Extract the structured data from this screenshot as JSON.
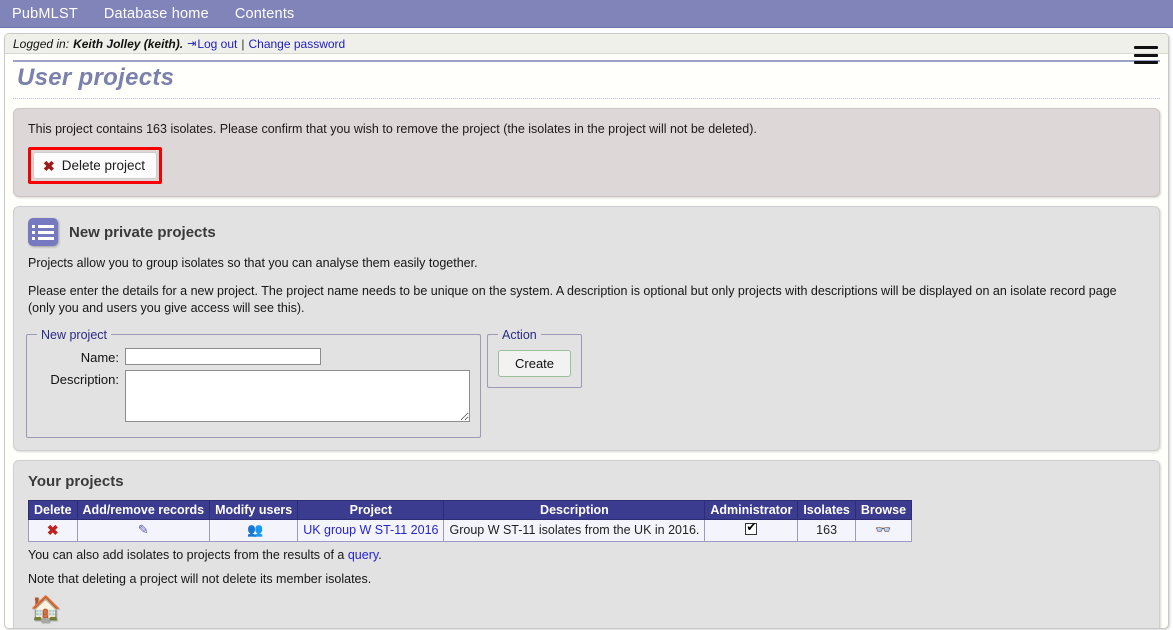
{
  "topnav": {
    "items": [
      {
        "label": "PubMLST",
        "name": "nav-pubmlst"
      },
      {
        "label": "Database home",
        "name": "nav-database-home"
      },
      {
        "label": "Contents",
        "name": "nav-contents"
      }
    ]
  },
  "loginbar": {
    "prefix": "Logged in:",
    "user": "Keith Jolley (keith).",
    "logout_icon": "logout-icon",
    "logout_label": "Log out",
    "separator": "|",
    "change_password_label": "Change password",
    "menu_icon": "hamburger-menu-icon"
  },
  "page": {
    "title": "User projects"
  },
  "warning": {
    "message": "This project contains 163 isolates. Please confirm that you wish to remove the project (the isolates in the project will not be deleted).",
    "isolate_count": "163",
    "delete_button_label": "Delete project",
    "delete_icon": "cross-icon",
    "annotation_color": "#f60000",
    "background_color": "#ded7d7"
  },
  "new_projects": {
    "icon": "list-icon",
    "heading": "New private projects",
    "paragraph1": "Projects allow you to group isolates so that you can analyse them easily together.",
    "paragraph2": "Please enter the details for a new project. The project name needs to be unique on the system. A description is optional but only projects with descriptions will be displayed on an isolate record page (only you and users you give access will see this).",
    "fieldset_legend": "New project",
    "action_legend": "Action",
    "name_label": "Name:",
    "name_value": "",
    "name_placeholder": "",
    "description_label": "Description:",
    "description_value": "",
    "description_placeholder": "",
    "create_label": "Create"
  },
  "your_projects": {
    "heading": "Your projects",
    "columns": [
      "Delete",
      "Add/remove records",
      "Modify users",
      "Project",
      "Description",
      "Administrator",
      "Isolates",
      "Browse"
    ],
    "rows": [
      {
        "delete_icon": "cross-icon",
        "edit_icon": "pencil-icon",
        "users_icon": "users-group-icon",
        "project": "UK group W ST-11 2016",
        "description": "Group W ST-11 isolates from the UK in 2016.",
        "administrator_icon": "checked-checkbox-icon",
        "isolates": "163",
        "browse_icon": "binoculars-icon"
      }
    ],
    "note1_before": "You can also add isolates to projects from the results of a ",
    "note1_link": "query",
    "note1_after": ".",
    "note2": "Note that deleting a project will not delete its member isolates.",
    "home_icon": "home-icon"
  }
}
